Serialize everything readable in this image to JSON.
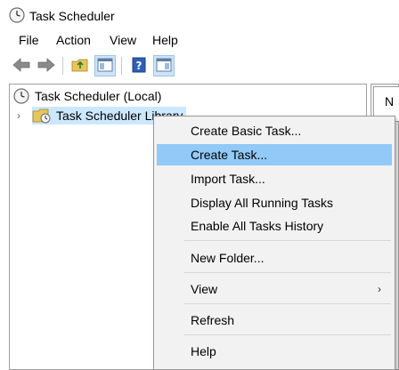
{
  "window": {
    "title": "Task Scheduler"
  },
  "menubar": {
    "items": [
      "File",
      "Action",
      "View",
      "Help"
    ]
  },
  "toolbar": {
    "buttons": [
      "back-arrow-icon",
      "forward-arrow-icon",
      "up-folder-icon",
      "show-hide-console-tree-icon",
      "help-icon",
      "show-hide-action-pane-icon"
    ]
  },
  "tree": {
    "root_label": "Task Scheduler (Local)",
    "library_label": "Task Scheduler Library"
  },
  "right_pane": {
    "header": "N"
  },
  "context_menu": {
    "items": [
      "Create Basic Task...",
      "Create Task...",
      "Import Task...",
      "Display All Running Tasks",
      "Enable All Tasks History",
      "New Folder...",
      "View",
      "Refresh",
      "Help"
    ],
    "highlighted": "Create Task...",
    "submenu_arrow": "›"
  },
  "colors": {
    "highlight": "#91c9f7",
    "selected": "#cce8ff",
    "menu_bg": "#f2f2f2"
  }
}
